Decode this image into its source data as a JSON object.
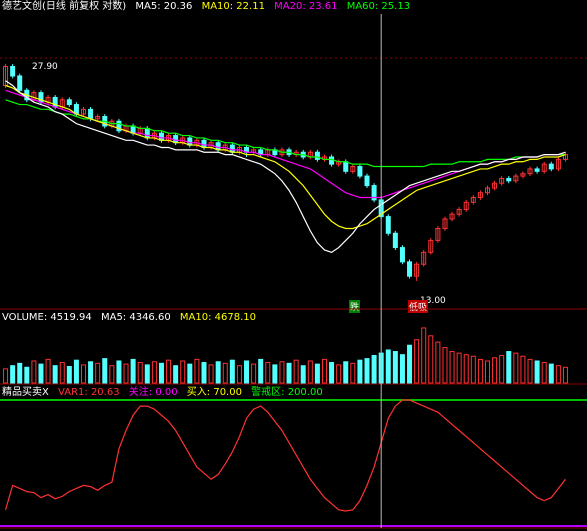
{
  "colors": {
    "up": "#ff3232",
    "down": "#54ffff",
    "ma5": "#ffffff",
    "ma10": "#ffff00",
    "ma20": "#ff00ff",
    "ma60": "#00ff00",
    "grid": "#8b0000",
    "text": "#ffffff",
    "crosshair": "#bbbbbb",
    "orange": "#ffa500"
  },
  "price_panel": {
    "title": "德艺文创(日线 前复权 对数)",
    "ma5": "MA5: 20.36",
    "ma10": "MA10: 22.11",
    "ma20": "MA20: 23.61",
    "ma60": "MA60: 25.13",
    "high_label": "27.90",
    "low_label": "13.00",
    "signal_fall": "跌",
    "signal_buy": "低吸"
  },
  "volume_panel": {
    "vol": "VOLUME: 4519.94",
    "ma5": "MA5: 4346.60",
    "ma10": "MA10: 4678.10"
  },
  "indicator_panel": {
    "name": "精品买卖X",
    "var1": "VAR1: 20.63",
    "focus": "关注: 0.00",
    "buy": "买入: 70.00",
    "warn": "警戒区: 200.00"
  },
  "chart_data": {
    "type": "candlestick",
    "candles": [
      [
        30,
        22,
        31,
        21
      ],
      [
        22,
        26,
        27,
        21
      ],
      [
        26,
        32,
        33,
        25
      ],
      [
        32,
        36,
        37,
        31
      ],
      [
        36,
        33,
        37,
        32
      ],
      [
        33,
        37,
        38,
        32
      ],
      [
        37,
        35,
        38,
        34
      ],
      [
        35,
        39,
        40,
        34
      ],
      [
        39,
        36,
        40,
        35
      ],
      [
        36,
        38,
        39,
        35
      ],
      [
        38,
        42,
        43,
        37
      ],
      [
        42,
        40,
        43,
        39
      ],
      [
        40,
        44,
        45,
        39
      ],
      [
        44,
        43,
        45,
        42
      ],
      [
        43,
        47,
        48,
        42
      ],
      [
        47,
        45,
        48,
        44
      ],
      [
        45,
        49,
        50,
        44
      ],
      [
        49,
        47,
        50,
        46
      ],
      [
        47,
        50,
        51,
        46
      ],
      [
        50,
        48,
        51,
        47
      ],
      [
        48,
        52,
        53,
        47
      ],
      [
        52,
        50,
        53,
        49
      ],
      [
        50,
        53,
        54,
        49
      ],
      [
        53,
        51,
        54,
        50
      ],
      [
        51,
        54,
        55,
        50
      ],
      [
        54,
        52,
        55,
        51
      ],
      [
        52,
        55,
        56,
        51
      ],
      [
        55,
        53,
        56,
        52
      ],
      [
        53,
        56,
        57,
        52
      ],
      [
        56,
        54,
        57,
        53
      ],
      [
        54,
        57,
        58,
        53
      ],
      [
        57,
        55,
        58,
        54
      ],
      [
        55,
        58,
        59,
        54
      ],
      [
        58,
        56,
        59,
        55
      ],
      [
        56,
        58,
        60,
        55
      ],
      [
        58,
        57,
        59,
        56
      ],
      [
        57,
        59,
        60,
        56
      ],
      [
        59,
        57,
        60,
        56
      ],
      [
        57,
        59,
        60,
        56
      ],
      [
        59,
        57,
        60,
        56
      ],
      [
        57,
        59,
        60,
        56
      ],
      [
        59,
        58,
        60,
        57
      ],
      [
        58,
        60,
        61,
        57
      ],
      [
        60,
        58,
        61,
        57
      ],
      [
        58,
        61,
        62,
        57
      ],
      [
        61,
        60,
        62,
        59
      ],
      [
        60,
        63,
        64,
        59
      ],
      [
        63,
        62,
        64,
        61
      ],
      [
        62,
        66,
        67,
        61
      ],
      [
        66,
        64,
        67,
        63
      ],
      [
        64,
        68,
        69,
        63
      ],
      [
        68,
        72,
        73,
        67
      ],
      [
        72,
        78,
        79,
        71
      ],
      [
        78,
        85,
        86,
        77
      ],
      [
        85,
        92,
        93,
        84
      ],
      [
        92,
        98,
        99,
        91
      ],
      [
        98,
        104,
        105,
        97
      ],
      [
        104,
        110,
        111,
        103
      ],
      [
        110,
        105,
        112,
        104
      ],
      [
        105,
        100,
        106,
        99
      ],
      [
        100,
        95,
        101,
        94
      ],
      [
        95,
        90,
        96,
        89
      ],
      [
        90,
        86,
        91,
        85
      ],
      [
        86,
        84,
        87,
        83
      ],
      [
        84,
        82,
        85,
        81
      ],
      [
        82,
        79,
        83,
        78
      ],
      [
        79,
        77,
        80,
        76
      ],
      [
        77,
        75,
        78,
        74
      ],
      [
        75,
        73,
        76,
        72
      ],
      [
        73,
        71,
        74,
        70
      ],
      [
        71,
        69,
        72,
        68
      ],
      [
        69,
        70,
        71,
        68
      ],
      [
        70,
        68,
        71,
        67
      ],
      [
        68,
        67,
        69,
        66
      ],
      [
        67,
        65,
        68,
        64
      ],
      [
        65,
        66,
        67,
        64
      ],
      [
        66,
        63,
        67,
        62
      ],
      [
        63,
        65,
        66,
        62
      ],
      [
        65,
        61,
        66,
        60
      ],
      [
        61,
        59,
        62,
        58
      ]
    ],
    "ma5": [
      28,
      30,
      33,
      35,
      37,
      38,
      39,
      41,
      42,
      44,
      46,
      47,
      48,
      49,
      50,
      51,
      52,
      53,
      53,
      54,
      55,
      55,
      56,
      56,
      57,
      57,
      57,
      57,
      58,
      58,
      58,
      59,
      59,
      60,
      61,
      62,
      63,
      65,
      67,
      70,
      74,
      79,
      85,
      91,
      96,
      99,
      100,
      98,
      95,
      92,
      88,
      85,
      82,
      80,
      78,
      76,
      74,
      72,
      71,
      70,
      69,
      68,
      67,
      66,
      66,
      65,
      64,
      63,
      63,
      62,
      62,
      61,
      61,
      60,
      60,
      60,
      59,
      59,
      59,
      58
    ],
    "ma10": [
      30,
      31,
      33,
      34,
      35,
      36,
      37,
      38,
      39,
      40,
      42,
      43,
      44,
      45,
      46,
      47,
      48,
      49,
      50,
      51,
      52,
      52,
      53,
      53,
      54,
      54,
      55,
      55,
      56,
      56,
      57,
      57,
      58,
      58,
      59,
      59,
      60,
      61,
      62,
      64,
      66,
      69,
      72,
      76,
      80,
      84,
      87,
      89,
      90,
      90,
      89,
      88,
      86,
      84,
      82,
      80,
      78,
      76,
      74,
      73,
      72,
      71,
      70,
      69,
      68,
      67,
      66,
      65,
      65,
      64,
      63,
      63,
      62,
      62,
      61,
      61,
      60,
      60,
      60,
      59
    ],
    "ma20": [
      32,
      33,
      34,
      35,
      36,
      37,
      38,
      39,
      40,
      41,
      42,
      43,
      44,
      45,
      46,
      47,
      48,
      49,
      50,
      50,
      51,
      51,
      52,
      52,
      53,
      53,
      54,
      54,
      55,
      55,
      56,
      56,
      57,
      57,
      58,
      58,
      59,
      59,
      60,
      61,
      62,
      63,
      64,
      65,
      67,
      69,
      71,
      73,
      75,
      76,
      77,
      77,
      77,
      77,
      76,
      75,
      74,
      73,
      72,
      71,
      70,
      69,
      68,
      67,
      66,
      65,
      64,
      63,
      63,
      62,
      62,
      61,
      61,
      60,
      60,
      60,
      59,
      59,
      59,
      58
    ],
    "ma60": [
      36,
      37,
      38,
      38,
      39,
      40,
      40,
      41,
      42,
      42,
      43,
      44,
      44,
      45,
      45,
      46,
      46,
      47,
      47,
      48,
      48,
      49,
      49,
      50,
      50,
      51,
      51,
      52,
      52,
      53,
      53,
      54,
      54,
      55,
      55,
      56,
      56,
      57,
      57,
      58,
      58,
      59,
      59,
      60,
      60,
      61,
      61,
      62,
      62,
      63,
      63,
      63,
      64,
      64,
      64,
      64,
      64,
      64,
      64,
      64,
      63,
      63,
      63,
      63,
      62,
      62,
      62,
      62,
      61,
      61,
      61,
      61,
      60,
      60,
      60,
      60,
      59,
      59,
      59,
      59
    ],
    "volumes": [
      18,
      22,
      25,
      20,
      28,
      24,
      30,
      22,
      26,
      21,
      29,
      23,
      27,
      25,
      31,
      22,
      28,
      24,
      30,
      26,
      23,
      27,
      25,
      29,
      22,
      28,
      24,
      30,
      26,
      23,
      27,
      25,
      29,
      22,
      28,
      24,
      30,
      26,
      23,
      27,
      25,
      29,
      22,
      28,
      24,
      30,
      26,
      23,
      27,
      25,
      29,
      31,
      35,
      38,
      42,
      40,
      36,
      48,
      55,
      70,
      60,
      52,
      45,
      40,
      38,
      36,
      34,
      30,
      28,
      32,
      35,
      40,
      38,
      34,
      30,
      28,
      26,
      24,
      22,
      20
    ],
    "var1": [
      20,
      60,
      55,
      50,
      48,
      40,
      45,
      38,
      42,
      50,
      55,
      60,
      58,
      52,
      60,
      65,
      120,
      150,
      175,
      190,
      190,
      185,
      175,
      165,
      150,
      130,
      110,
      90,
      80,
      70,
      78,
      95,
      115,
      140,
      170,
      185,
      190,
      180,
      165,
      150,
      130,
      110,
      90,
      70,
      55,
      40,
      30,
      20,
      18,
      20,
      35,
      60,
      90,
      130,
      170,
      190,
      200,
      200,
      195,
      190,
      185,
      180,
      170,
      160,
      150,
      140,
      130,
      120,
      110,
      100,
      90,
      80,
      70,
      60,
      50,
      40,
      35,
      40,
      55,
      70
    ]
  }
}
